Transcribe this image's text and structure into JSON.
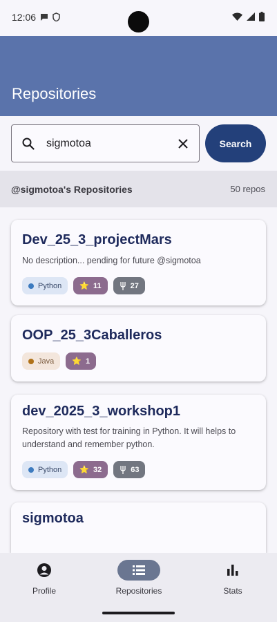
{
  "status_bar": {
    "time": "12:06"
  },
  "app_bar": {
    "title": "Repositories"
  },
  "search": {
    "value": "sigmotoa",
    "button_label": "Search"
  },
  "list_header": {
    "title": "@sigmotoa's Repositories",
    "count": "50 repos"
  },
  "repos": [
    {
      "name": "Dev_25_3_projectMars",
      "description": "No description... pending for future @sigmotoa",
      "language": "Python",
      "stars": "11",
      "forks": "27"
    },
    {
      "name": "OOP_25_3Caballeros",
      "description": "",
      "language": "Java",
      "stars": "1",
      "forks": ""
    },
    {
      "name": "dev_2025_3_workshop1",
      "description": "Repository with test for training in Python. It will helps to understand and remember python.",
      "language": "Python",
      "stars": "32",
      "forks": "63"
    },
    {
      "name": "sigmotoa"
    }
  ],
  "colors": {
    "python": "#3d7bbf",
    "java": "#b07219",
    "app_bar": "#5a73ab",
    "search_button": "#23407a"
  },
  "bottom_nav": {
    "items": [
      {
        "label": "Profile",
        "icon": "account-circle-icon"
      },
      {
        "label": "Repositories",
        "icon": "list-icon",
        "active": true
      },
      {
        "label": "Stats",
        "icon": "bar-chart-icon"
      }
    ]
  }
}
